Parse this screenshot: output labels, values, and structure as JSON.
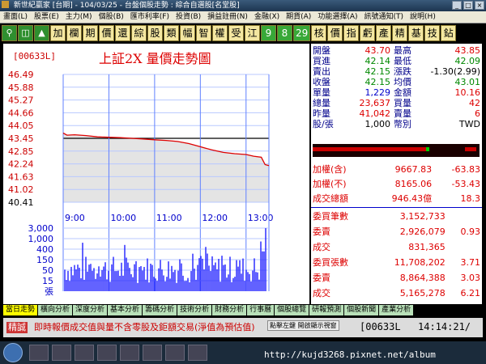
{
  "window": {
    "title": "新世紀贏家 [台期] - 104/03/25 - 台盤個股走勢 : 綜合自選股[名堂股]"
  },
  "menu": [
    "畫面(L)",
    "股票(E)",
    "主力(M)",
    "個股(B)",
    "匯市利率(F)",
    "投資(B)",
    "損益註冊(N)",
    "金融(X)",
    "期貨(A)",
    "功能選擇(A)",
    "訊號通知(T)",
    "說明(H)"
  ],
  "toolbar": [
    "加",
    "欄",
    "期",
    "價",
    "還",
    "綜",
    "股",
    "類",
    "幅",
    "智",
    "權",
    "受",
    "江",
    "9",
    "8",
    "29",
    "核",
    "價",
    "指",
    "虧",
    "產",
    "精",
    "基",
    "技",
    "鉆"
  ],
  "chart": {
    "code": "[00633L]",
    "title": "上証2X  量價走勢圖"
  },
  "chart_data": {
    "type": "line",
    "title": "上証2X  量價走勢圖",
    "price_ticks": [
      "46.49",
      "45.88",
      "45.27",
      "44.66",
      "44.05",
      "43.45",
      "42.85",
      "42.24",
      "41.63",
      "41.02",
      "40.41"
    ],
    "ylim": [
      40.41,
      46.49
    ],
    "reference_price": 43.45,
    "volume_ticks": [
      "3,000",
      "1,000",
      "400",
      "150",
      "50",
      "15",
      "張"
    ],
    "time_ticks": [
      "9:00",
      "10:00",
      "11:00",
      "12:00",
      "13:00"
    ],
    "series": [
      {
        "values": [
          [
            "9:00",
            43.7
          ],
          [
            "9:05",
            43.6
          ],
          [
            "9:15",
            43.62
          ],
          [
            "9:30",
            43.58
          ],
          [
            "9:45",
            43.52
          ],
          [
            "10:00",
            43.5
          ],
          [
            "10:15",
            43.48
          ],
          [
            "10:30",
            43.45
          ],
          [
            "10:45",
            43.42
          ],
          [
            "11:00",
            43.38
          ],
          [
            "11:15",
            43.35
          ],
          [
            "11:30",
            43.3
          ],
          [
            "11:45",
            43.2
          ],
          [
            "12:00",
            43.05
          ],
          [
            "12:15",
            42.9
          ],
          [
            "12:30",
            42.78
          ],
          [
            "12:45",
            42.72
          ],
          [
            "13:00",
            42.68
          ],
          [
            "13:10",
            42.6
          ],
          [
            "13:20",
            42.55
          ],
          [
            "13:25",
            42.2
          ],
          [
            "13:30",
            42.15
          ]
        ]
      }
    ]
  },
  "quote": {
    "rows1": [
      {
        "l1": "開盤",
        "v1": "43.70",
        "c1": "red",
        "l2": "最高",
        "v2": "43.85",
        "c2": "red"
      },
      {
        "l1": "買進",
        "v1": "42.14",
        "c1": "grn",
        "l2": "最低",
        "v2": "42.09",
        "c2": "grn"
      },
      {
        "l1": "賣出",
        "v1": "42.15",
        "c1": "grn",
        "l2": "漲跌",
        "v2": "-1.30(2.99)",
        "c2": "blk"
      },
      {
        "l1": "收盤",
        "v1": "42.15",
        "c1": "grn",
        "l2": "均價",
        "v2": "43.01",
        "c2": "grn"
      },
      {
        "l1": "單量",
        "v1": "1,229",
        "c1": "blu",
        "l2": "金額",
        "v2": "10.16",
        "c2": "red"
      },
      {
        "l1": "總量",
        "v1": "23,637",
        "c1": "red",
        "l2": "買量",
        "v2": "42",
        "c2": "red"
      },
      {
        "l1": "昨量",
        "v1": "41,042",
        "c1": "red",
        "l2": "賣量",
        "v2": "6",
        "c2": "red"
      },
      {
        "l1": "股/張",
        "v1": "1,000",
        "c1": "blk",
        "l2": "幣別",
        "v2": "TWD",
        "c2": "blk"
      }
    ],
    "rows2": [
      {
        "l": "加權(含)",
        "v": "9667.83",
        "d": "-63.83"
      },
      {
        "l": "加權(不)",
        "v": "8165.06",
        "d": "-53.43"
      },
      {
        "l": "成交總額",
        "v": "946.43億",
        "d": "18.3"
      }
    ],
    "rows3": [
      {
        "l": "委買筆數",
        "v": "3,152,733",
        "d": ""
      },
      {
        "l": "委賣",
        "v": "2,926,079",
        "d": "0.93"
      },
      {
        "l": "成交",
        "v": "831,365",
        "d": ""
      },
      {
        "l": "委買張數",
        "v": "11,708,202",
        "d": "3.71"
      },
      {
        "l": "委賣",
        "v": "8,864,388",
        "d": "3.03"
      },
      {
        "l": "成交",
        "v": "5,165,278",
        "d": "6.21"
      }
    ]
  },
  "tabs": [
    "當日走勢",
    "橫向分析",
    "深度分析",
    "基本分析",
    "籌碼分析",
    "技術分析",
    "財務分析",
    "行事曆",
    "個股總覽",
    "研報預測",
    "個股新聞",
    "產業分析"
  ],
  "status": {
    "label": "精誠",
    "text": "即時報價成交值與量不含零股及鉅額交易(淨值為預估值)",
    "button": "點擊左鍵 開啟顯示視窗",
    "code": "[00633L",
    "time": "14:14:21/"
  },
  "watermark": "http://kujd3268.pixnet.net/album"
}
